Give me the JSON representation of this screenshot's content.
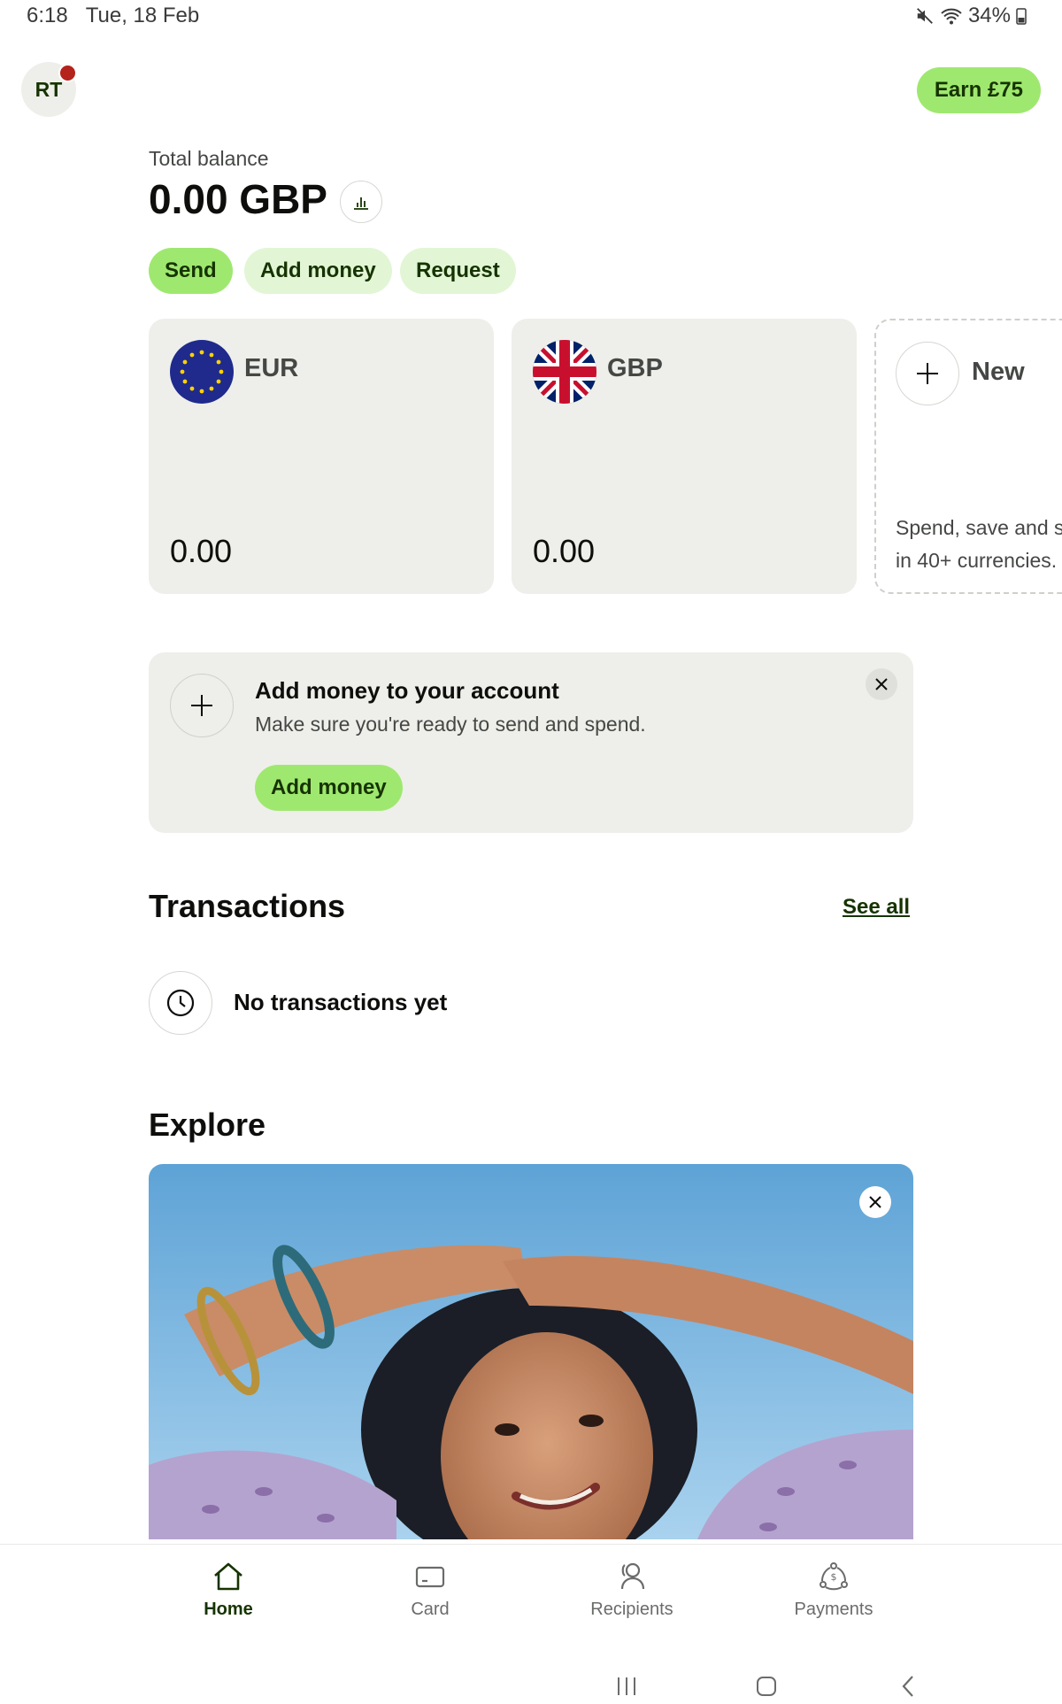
{
  "status_bar": {
    "time": "6:18",
    "date": "Tue, 18 Feb",
    "battery": "34%"
  },
  "header": {
    "avatar_initials": "RT",
    "earn_label": "Earn £75"
  },
  "balance": {
    "label": "Total balance",
    "amount": "0.00 GBP"
  },
  "actions": {
    "send": "Send",
    "add_money": "Add money",
    "request": "Request"
  },
  "currencies": [
    {
      "code": "EUR",
      "balance": "0.00",
      "flag_icon": "eu-flag-icon"
    },
    {
      "code": "GBP",
      "balance": "0.00",
      "flag_icon": "uk-flag-icon"
    }
  ],
  "new_currency": {
    "label": "New",
    "description_line1": "Spend, save and s",
    "description_line2": "in 40+ currencies."
  },
  "add_money_banner": {
    "title": "Add money to your account",
    "subtitle": "Make sure you're ready to send and spend.",
    "cta": "Add money"
  },
  "transactions": {
    "title": "Transactions",
    "see_all": "See all",
    "empty_text": "No transactions yet"
  },
  "explore": {
    "title": "Explore"
  },
  "bottom_nav": [
    {
      "label": "Home",
      "icon": "home-icon",
      "active": true
    },
    {
      "label": "Card",
      "icon": "card-icon",
      "active": false
    },
    {
      "label": "Recipients",
      "icon": "recipients-icon",
      "active": false
    },
    {
      "label": "Payments",
      "icon": "payments-icon",
      "active": false
    }
  ],
  "colors": {
    "accent": "#9fe870",
    "accent_light": "#e2f6d5",
    "dark_green": "#163300",
    "card_bg": "#eeefea",
    "notification_dot": "#b4241c"
  }
}
